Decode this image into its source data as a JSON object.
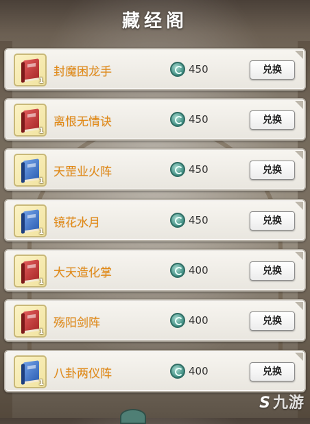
{
  "title": "藏经阁",
  "colors": {
    "item_name": "#e38a16",
    "currency": "#3f8e82"
  },
  "currency_icon": "jade-coin-icon",
  "items": [
    {
      "name": "封魔困龙手",
      "price": "450",
      "qty": "1",
      "book_color": "red",
      "button": "兑换"
    },
    {
      "name": "离恨无情诀",
      "price": "450",
      "qty": "1",
      "book_color": "red",
      "button": "兑换"
    },
    {
      "name": "天罡业火阵",
      "price": "450",
      "qty": "1",
      "book_color": "blue",
      "button": "兑换"
    },
    {
      "name": "镜花水月",
      "price": "450",
      "qty": "1",
      "book_color": "blue",
      "button": "兑换"
    },
    {
      "name": "大天造化掌",
      "price": "400",
      "qty": "1",
      "book_color": "red",
      "button": "兑换"
    },
    {
      "name": "殇阳剑阵",
      "price": "400",
      "qty": "1",
      "book_color": "red",
      "button": "兑换"
    },
    {
      "name": "八卦两仪阵",
      "price": "400",
      "qty": "1",
      "book_color": "blue",
      "button": "兑换"
    }
  ],
  "watermark": {
    "symbol": "S",
    "text": "九游"
  }
}
